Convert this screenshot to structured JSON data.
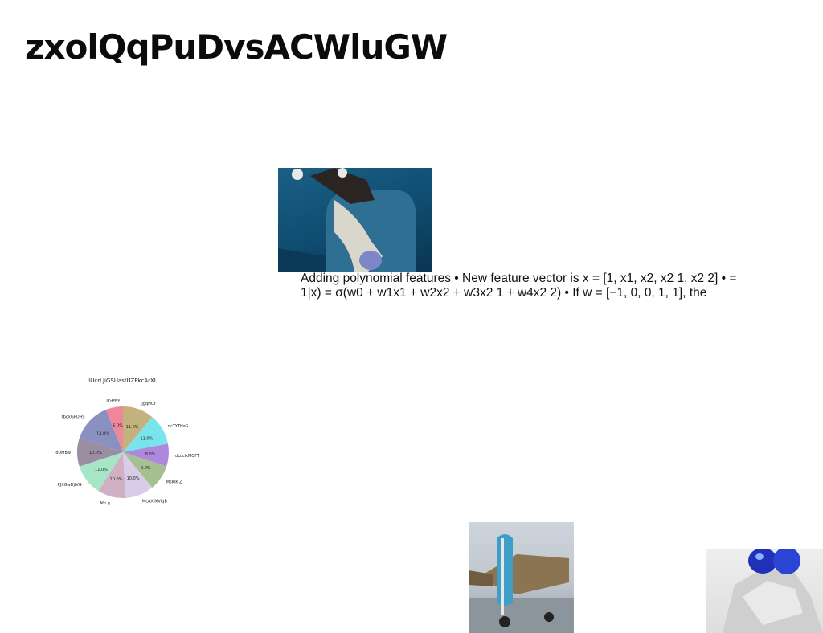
{
  "page": {
    "title": "zxolQqPuDvsACWluGW",
    "paragraph": "Adding polynomial features • New feature vector is x = [1, x1, x2, x2 1, x2 2] • = 1|x) = σ(w0 + w1x1 + w2x2 + w3x2 1 + w4x2 2) • If w = [−1, 0, 0, 1, 1], the"
  },
  "images": [
    {
      "name": "photo-person-in-armchair",
      "description": "person lying sideways on a blue armchair, blue background"
    },
    {
      "name": "photo-vintage-airplane",
      "description": "vintage propeller aircraft on runway"
    },
    {
      "name": "photo-blue-glass-on-rock",
      "description": "blue glass spheres resting on white rock"
    }
  ],
  "chart_data": {
    "type": "pie",
    "title": "lUcrLJiGSUasfUZPkcArXL",
    "labels": [
      "jjgqHOf",
      "qcTYTHsG",
      "dLuclkMQFT",
      "MsKiK Z",
      "McAXiMVlqB",
      "Afh g",
      "PJXGwDjIVG",
      "dUMBw",
      "tbqkGFOHS",
      "lKdFBY"
    ],
    "values": [
      11.0,
      11.0,
      8.0,
      9.0,
      10.0,
      10.0,
      11.0,
      10.0,
      14.0,
      6.0
    ],
    "pct_labels": [
      "11.0%",
      "11.0%",
      "8.0%",
      "9.0%",
      "10.0%",
      "10.0%",
      "11.0%",
      "10.0%",
      "14.0%",
      "6.0%"
    ],
    "colors": [
      "#c4b27e",
      "#7ae4ec",
      "#ad88dc",
      "#a7c092",
      "#d8cce9",
      "#d1b0c4",
      "#a6e6c6",
      "#9b8ea0",
      "#8a90c0",
      "#f0869a"
    ],
    "start_angle_deg": 90,
    "direction": "clockwise",
    "legend": "none"
  }
}
